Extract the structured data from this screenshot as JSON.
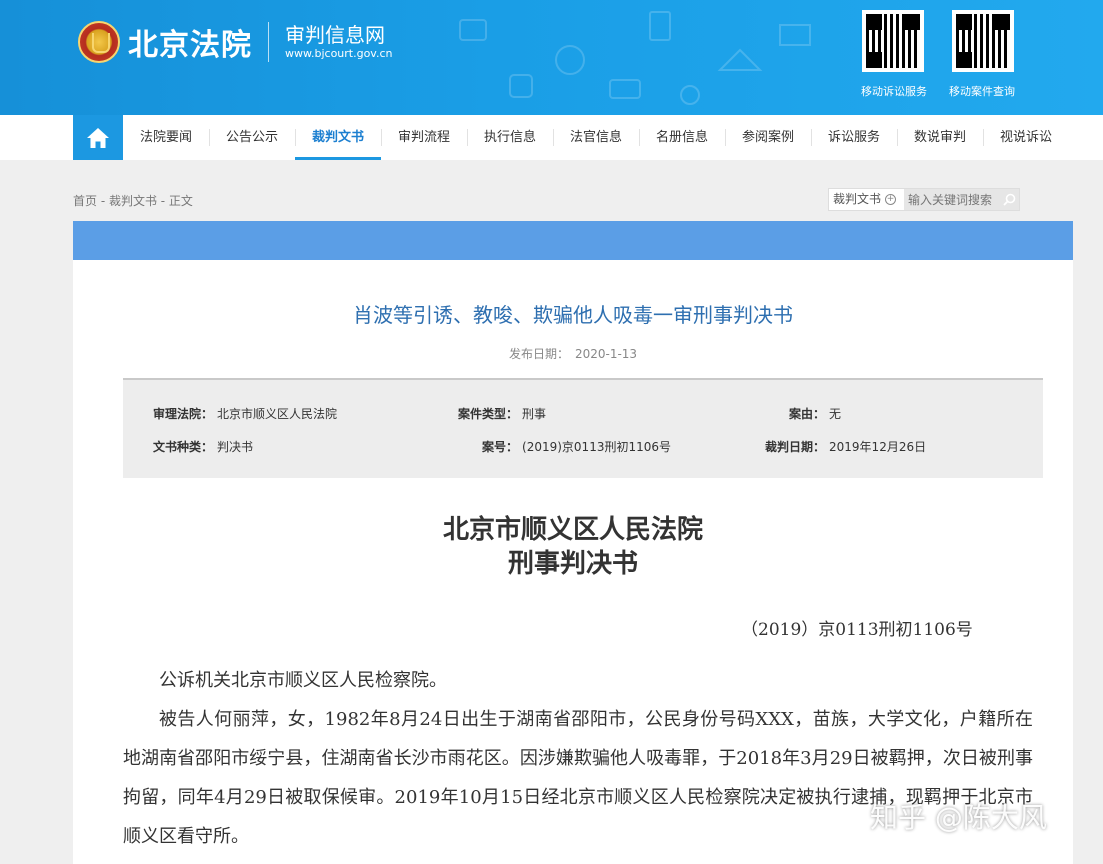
{
  "header": {
    "logo_name": "北京法院",
    "site_name": "审判信息网",
    "site_url": "www.bjcourt.gov.cn",
    "qr_codes": [
      {
        "caption": "移动诉讼服务"
      },
      {
        "caption": "移动案件查询"
      }
    ],
    "brand_color": "#1a9ee6"
  },
  "nav": {
    "home_icon": "home-icon",
    "items": [
      {
        "label": "法院要闻"
      },
      {
        "label": "公告公示"
      },
      {
        "label": "裁判文书"
      },
      {
        "label": "审判流程"
      },
      {
        "label": "执行信息"
      },
      {
        "label": "法官信息"
      },
      {
        "label": "名册信息"
      },
      {
        "label": "参阅案例"
      },
      {
        "label": "诉讼服务"
      },
      {
        "label": "数说审判"
      },
      {
        "label": "视说诉讼"
      }
    ],
    "active": "裁判文书"
  },
  "breadcrumb": "首页 - 裁判文书 - 正文",
  "search": {
    "category": "裁判文书",
    "placeholder": "输入关键词搜索"
  },
  "document": {
    "title": "肖波等引诱、教唆、欺骗他人吸毒一审刑事判决书",
    "pub_date_label": "发布日期：",
    "pub_date": "2020-1-13",
    "info": {
      "court_label": "审理法院：",
      "court": "北京市顺义区人民法院",
      "case_type_label": "案件类型：",
      "case_type": "刑事",
      "cause_label": "案由：",
      "cause": "无",
      "doc_kind_label": "文书种类：",
      "doc_kind": "判决书",
      "case_no_label": "案号：",
      "case_no": "(2019)京0113刑初1106号",
      "judge_date_label": "裁判日期：",
      "judge_date": "2019年12月26日"
    },
    "court_name": "北京市顺义区人民法院",
    "doc_type": "刑事判决书",
    "case_ref": "（2019）京0113刑初1106号",
    "paragraphs": [
      "公诉机关北京市顺义区人民检察院。",
      "被告人何丽萍，女，1982年8月24日出生于湖南省邵阳市，公民身份号码XXX，苗族，大学文化，户籍所在地湖南省邵阳市绥宁县，住湖南省长沙市雨花区。因涉嫌欺骗他人吸毒罪，于2018年3月29日被羁押，次日被刑事拘留，同年4月29日被取保候审。2019年10月15日经北京市顺义区人民检察院决定被执行逮捕，现羁押于北京市顺义区看守所。"
    ]
  },
  "watermark": "知乎 @陈大风"
}
